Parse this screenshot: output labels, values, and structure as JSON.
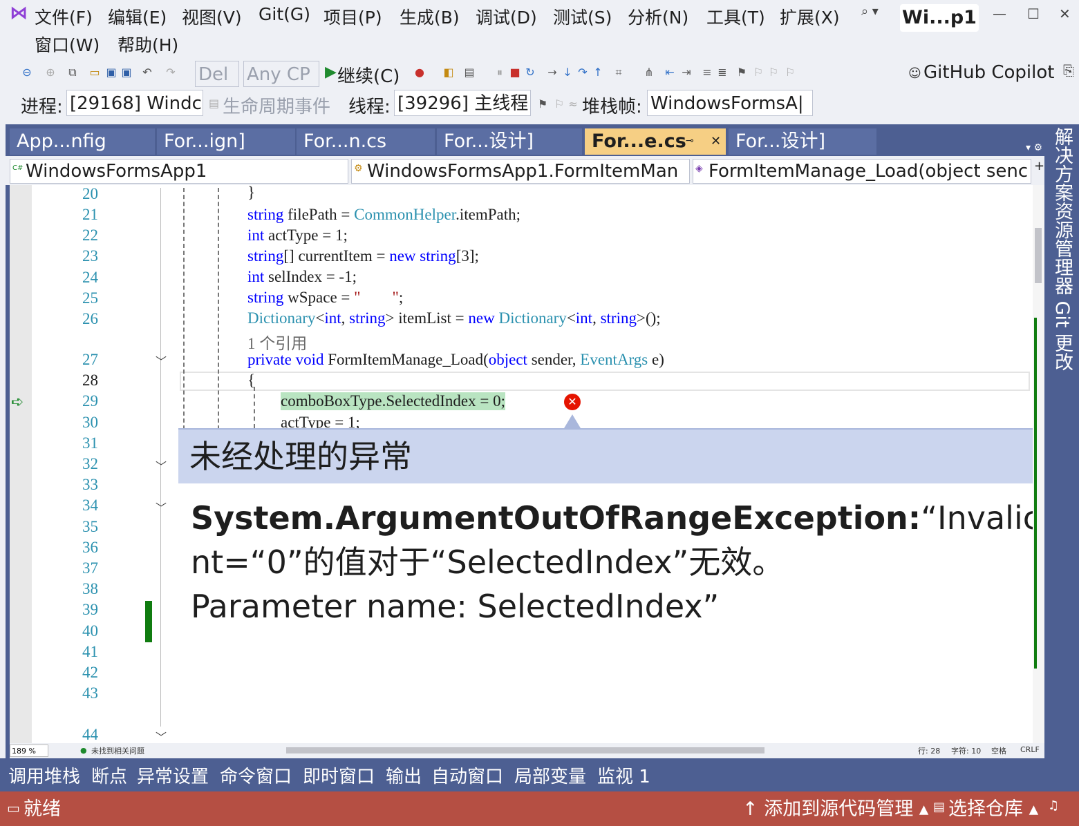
{
  "menu": {
    "row1": [
      "文件(F)",
      "编辑(E)",
      "视图(V)",
      "Git(G)",
      "项目(P)",
      "生成(B)",
      "调试(D)",
      "测试(S)",
      "分析(N)",
      "工具(T)",
      "扩展(X)"
    ],
    "row2": [
      "窗口(W)",
      "帮助(H)"
    ],
    "search": "⌕ ▾",
    "title": "Wi...p1",
    "win_controls": [
      "—",
      "☐",
      "✕"
    ]
  },
  "toolbar": {
    "config": "Del",
    "platform": "Any CP",
    "continue": "继续(C)",
    "copilot": "GitHub Copilot",
    "process_label": "进程:",
    "process_value": "[29168] Windc",
    "lifecycle": "生命周期事件",
    "thread_label": "线程:",
    "thread_value": "[39296] 主线程",
    "stack_label": "堆栈帧:",
    "stack_value": "WindowsFormsA|"
  },
  "tabs": [
    {
      "label": "App...nfig"
    },
    {
      "label": "For...ign]"
    },
    {
      "label": "For...n.cs"
    },
    {
      "label": "For...设计]"
    },
    {
      "label": "For...e.cs"
    },
    {
      "label": "For...设计]"
    }
  ],
  "nav": {
    "project": "WindowsFormsApp1",
    "class": "WindowsFormsApp1.FormItemMan",
    "member": "FormItemManage_Load(object senc"
  },
  "code": {
    "line_numbers": [
      "20",
      "21",
      "22",
      "23",
      "24",
      "25",
      "26",
      "27",
      "28",
      "29",
      "30",
      "31",
      "32",
      "33",
      "34",
      "35",
      "36",
      "37",
      "38",
      "39",
      "40",
      "41",
      "42",
      "43",
      "44"
    ],
    "l20": "}",
    "l21_kw": "string",
    "l21_a": " filePath = ",
    "l21_ty": "CommonHelper",
    "l21_b": ".itemPath;",
    "l22_kw": "int",
    "l22_a": " actType = 1;",
    "l23_kw": "string",
    "l23_a": "[] currentItem = ",
    "l23_kw2": "new",
    "l23_kw3": " string",
    "l23_b": "[3];",
    "l24_kw": "int",
    "l24_a": " selIndex = -1;",
    "l25_kw": "string",
    "l25_a": " wSpace = ",
    "l25_str": "\"        \"",
    "l25_b": ";",
    "l26_ty": "Dictionary",
    "l26_a": "<",
    "l26_kw": "int",
    "l26_b": ", ",
    "l26_kw2": "string",
    "l26_c": "> itemList = ",
    "l26_kw3": "new",
    "l26_ty2": " Dictionary",
    "l26_d": "<",
    "l26_kw4": "int",
    "l26_e": ", ",
    "l26_kw5": "string",
    "l26_f": ">();",
    "refs": "1 个引用",
    "l27_kw": "private",
    "l27_kw2": " void",
    "l27_a": " FormItemManage_Load(",
    "l27_kw3": "object",
    "l27_b": " sender, ",
    "l27_ty": "EventArgs",
    "l27_c": " e)",
    "l28": "{",
    "l29": "comboBoxType.SelectedIndex = 0;",
    "l30": "actType = 1;"
  },
  "exception": {
    "title": "未经处理的异常",
    "type": "System.ArgumentOutOfRangeException:",
    "msg1": "“Invalic",
    "msg2": "nt=“0”的值对于“SelectedIndex”无效。",
    "msg3": "Parameter name: SelectedIndex”"
  },
  "bottom": {
    "zoom": "189 %",
    "issues": "未找到相关问题",
    "line": "行: 28",
    "char": "字符: 10",
    "space": "空格",
    "eol": "CRLF"
  },
  "right_rail": "解决方案资源管理器  Git 更改",
  "tool_tabs": [
    "调用堆栈",
    "断点",
    "异常设置",
    "命令窗口",
    "即时窗口",
    "输出",
    "自动窗口",
    "局部变量",
    "监视 1"
  ],
  "status": {
    "ready": "就绪",
    "add_source": "↑ 添加到源代码管理 ▴",
    "select_repo": "选择仓库 ▴"
  }
}
